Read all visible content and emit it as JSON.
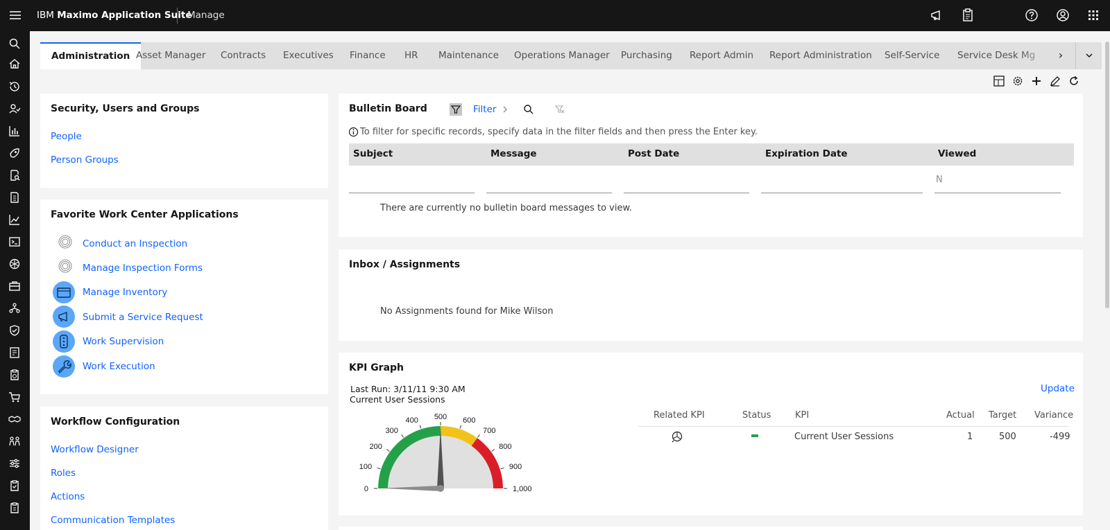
{
  "header": {
    "brand_prefix": "IBM",
    "brand_name": "Maximo Application Suite",
    "app_name": "Manage",
    "icons": [
      "menu-icon",
      "announcement-icon",
      "clipboard-icon",
      "help-icon",
      "user-avatar-icon",
      "app-switcher-icon"
    ]
  },
  "sidenav": {
    "icons": [
      "search-icon",
      "home-icon",
      "recent-icon",
      "people-icon",
      "chart-bar-icon",
      "rocket-icon",
      "report-search-icon",
      "report-icon",
      "line-chart-icon",
      "terminal-icon",
      "network-icon",
      "toolbox-icon",
      "connection-icon",
      "shield-icon",
      "document-icon",
      "clipboard-time-icon",
      "cart-icon",
      "handshake-icon",
      "group-icon",
      "sliders-icon",
      "clipboard-check-icon",
      "clipboard-list-icon"
    ]
  },
  "tabs": [
    {
      "label": "Administration",
      "active": true
    },
    {
      "label": "Asset Manager"
    },
    {
      "label": "Contracts"
    },
    {
      "label": "Executives"
    },
    {
      "label": "Finance"
    },
    {
      "label": "HR"
    },
    {
      "label": "Maintenance"
    },
    {
      "label": "Operations Manager"
    },
    {
      "label": "Purchasing"
    },
    {
      "label": "Report Admin"
    },
    {
      "label": "Report Administration"
    },
    {
      "label": "Self-Service"
    },
    {
      "label": "Service Desk Mg"
    }
  ],
  "security": {
    "title": "Security, Users and Groups",
    "links": [
      "People",
      "Person Groups"
    ]
  },
  "favorites": {
    "title": "Favorite Work Center Applications",
    "items": [
      {
        "label": "Conduct an Inspection",
        "icon": "inspection-icon"
      },
      {
        "label": "Manage Inspection Forms",
        "icon": "inspection-forms-icon"
      },
      {
        "label": "Manage Inventory",
        "icon": "inventory-icon"
      },
      {
        "label": "Submit a Service Request",
        "icon": "megaphone-icon"
      },
      {
        "label": "Work Supervision",
        "icon": "supervision-icon"
      },
      {
        "label": "Work Execution",
        "icon": "wrench-icon"
      }
    ]
  },
  "workflow": {
    "title": "Workflow Configuration",
    "links": [
      "Workflow Designer",
      "Roles",
      "Actions",
      "Communication Templates"
    ]
  },
  "bulletin": {
    "title": "Bulletin Board",
    "filter_label": "Filter",
    "hint": "To filter for specific records, specify data in the filter fields and then press the Enter key.",
    "columns": [
      "Subject",
      "Message",
      "Post Date",
      "Expiration Date",
      "Viewed"
    ],
    "viewed_filter": "N",
    "empty": "There are currently no bulletin board messages to view."
  },
  "inbox": {
    "title": "Inbox / Assignments",
    "empty": "No Assignments found for Mike Wilson"
  },
  "kpi": {
    "title": "KPI Graph",
    "last_run": "Last Run: 3/11/11 9:30 AM",
    "subtitle": "Current User Sessions",
    "update_label": "Update",
    "columns": [
      "Related KPI",
      "Status",
      "KPI",
      "Actual",
      "Target",
      "Variance"
    ],
    "row": {
      "kpi": "Current User Sessions",
      "actual": "1",
      "target": "500",
      "variance": "-499"
    },
    "status_color": "#24a148"
  },
  "chart_data": {
    "type": "gauge",
    "min": 0,
    "max": 1000,
    "value": 1,
    "target": 500,
    "ticks": [
      0,
      100,
      200,
      300,
      400,
      500,
      600,
      700,
      800,
      900,
      1000
    ],
    "tick_labels": [
      "0",
      "100",
      "200",
      "300",
      "400",
      "500",
      "600",
      "700",
      "800",
      "900",
      "1,000"
    ],
    "bands": [
      {
        "from": 0,
        "to": 500,
        "color": "#24a148"
      },
      {
        "from": 500,
        "to": 700,
        "color": "#f1c21b"
      },
      {
        "from": 700,
        "to": 1000,
        "color": "#da1e28"
      }
    ]
  }
}
